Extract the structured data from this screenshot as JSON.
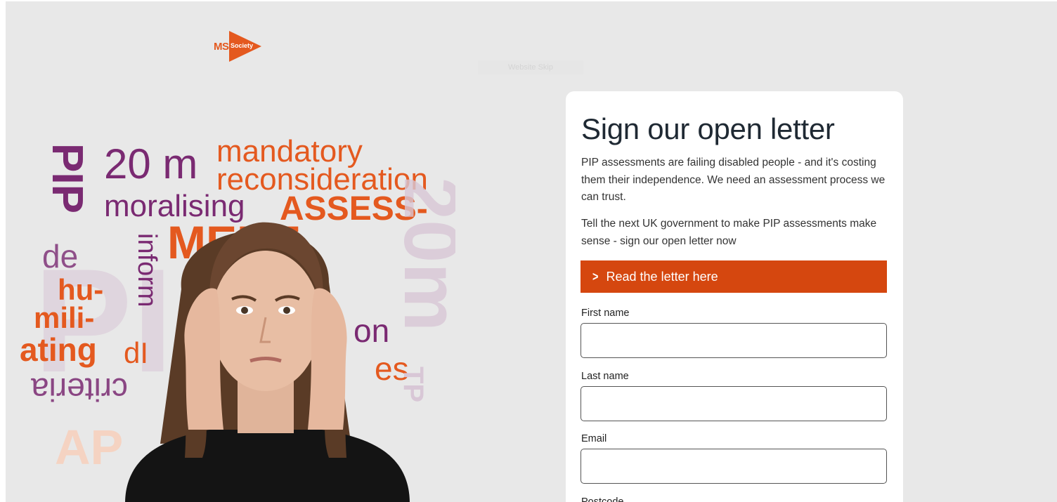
{
  "header": {
    "logo_text": "MS",
    "logo_subtext": "Society",
    "skip_link": "Website Skip"
  },
  "hero": {
    "words": [
      "PIP",
      "20 m",
      "mandatory",
      "reconsideration",
      "moralising",
      "ASSESS-",
      "MENT",
      "de",
      "inform",
      "hu-",
      "mili-",
      "ating",
      "dI",
      "on",
      "es",
      "criteria",
      "AP",
      "20m",
      "TP"
    ]
  },
  "form": {
    "title": "Sign our open letter",
    "intro_1": "PIP assessments are failing disabled people - and it's costing them their independence. We need an assessment process we can trust.",
    "intro_2": "Tell the next UK government to make PIP assessments make sense - sign our open letter now",
    "read_letter_label": "Read the letter here",
    "first_name": {
      "label": "First name",
      "value": ""
    },
    "last_name": {
      "label": "Last name",
      "value": ""
    },
    "email": {
      "label": "Email",
      "value": ""
    },
    "postcode": {
      "label": "Postcode"
    }
  },
  "colors": {
    "brand_orange": "#e4591f",
    "button_orange": "#d5470f",
    "brand_purple": "#7a2a72",
    "background": "#e8e8e8"
  }
}
